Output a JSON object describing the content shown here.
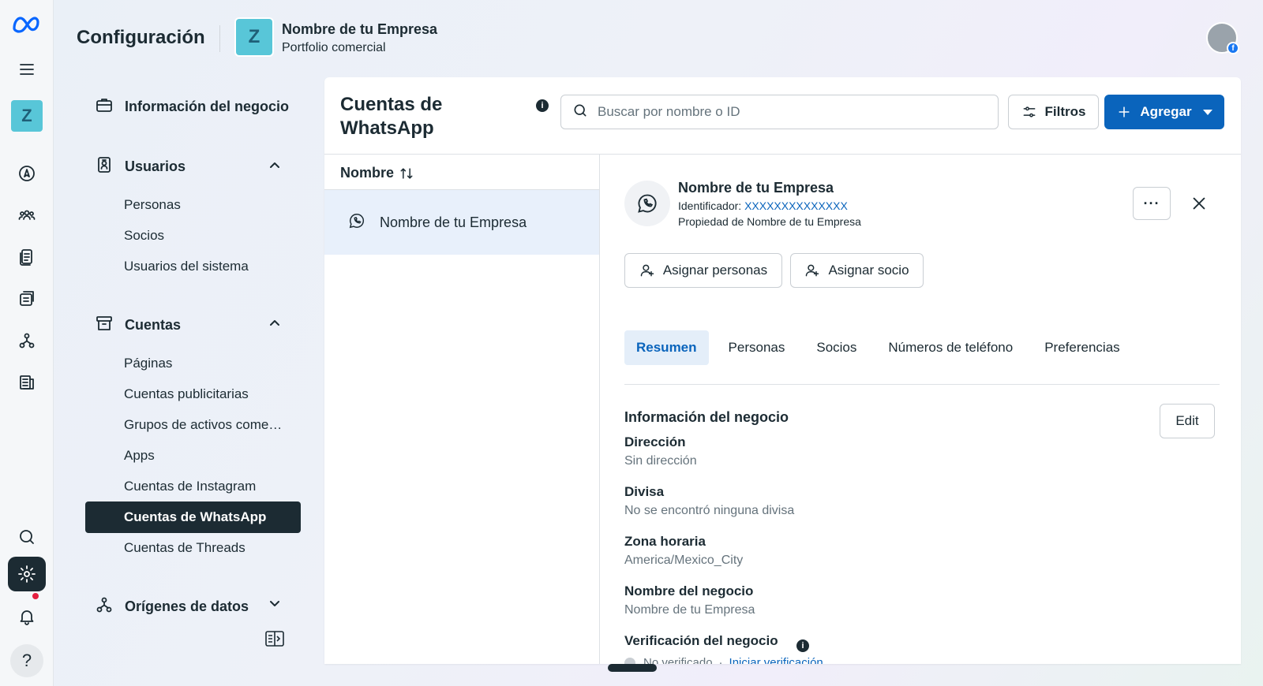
{
  "header": {
    "page_title": "Configuración",
    "business_initial": "Z",
    "business_name": "Nombre de tu Empresa",
    "business_subtitle": "Portfolio comercial"
  },
  "rail": {
    "business_initial": "Z",
    "help_label": "?",
    "icons": [
      "meta-logo-icon",
      "menu-icon",
      "compass-icon",
      "people-icon",
      "document-icon",
      "ads-icon",
      "integrations-icon",
      "database-icon",
      "search-icon",
      "settings-icon",
      "bell-icon",
      "help-icon"
    ]
  },
  "sidebar": {
    "business_info": "Información del negocio",
    "users": {
      "label": "Usuarios",
      "items": [
        "Personas",
        "Socios",
        "Usuarios del sistema"
      ]
    },
    "accounts": {
      "label": "Cuentas",
      "items": [
        "Páginas",
        "Cuentas publicitarias",
        "Grupos de activos come…",
        "Apps",
        "Cuentas de Instagram",
        "Cuentas de WhatsApp",
        "Cuentas de Threads"
      ],
      "active": "Cuentas de WhatsApp"
    },
    "data_sources": "Orígenes de datos"
  },
  "main": {
    "title": "Cuentas de WhatsApp",
    "info_icon": "i",
    "search_placeholder": "Buscar por nombre o ID",
    "filters_label": "Filtros",
    "add_label": "Agregar",
    "column_header": "Nombre",
    "list": [
      {
        "name": "Nombre de tu Empresa",
        "selected": true
      }
    ]
  },
  "detail": {
    "name": "Nombre de tu Empresa",
    "id_label": "Identificador: ",
    "id_value": "XXXXXXXXXXXXXX",
    "owner": "Propiedad de Nombre de tu Empresa",
    "more_label": "···",
    "assign_people": "Asignar personas",
    "assign_partner": "Asignar socio",
    "tabs": [
      "Resumen",
      "Personas",
      "Socios",
      "Números de teléfono",
      "Preferencias"
    ],
    "active_tab": "Resumen",
    "section_title": "Información del negocio",
    "edit_label": "Edit",
    "fields": [
      {
        "label": "Dirección",
        "value": "Sin dirección"
      },
      {
        "label": "Divisa",
        "value": "No se encontró ninguna divisa"
      },
      {
        "label": "Zona horaria",
        "value": "America/Mexico_City"
      },
      {
        "label": "Nombre del negocio",
        "value": "Nombre de tu Empresa"
      }
    ],
    "verification": {
      "label": "Verificación del negocio",
      "info_icon": "i",
      "status": "No verificado",
      "separator": "·",
      "link": "Iniciar verificación"
    }
  },
  "colors": {
    "primary": "#0a64bc",
    "dark": "#1c2b33",
    "selected_row": "#e8f0fb",
    "avatar_teal": "#58c6d8"
  }
}
